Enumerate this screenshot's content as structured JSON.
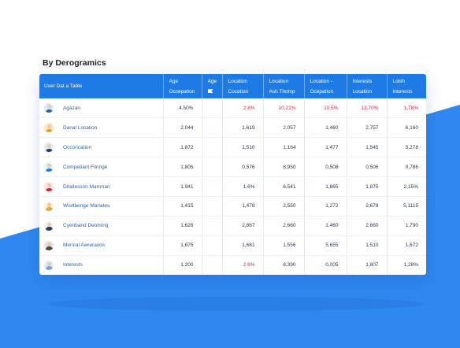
{
  "page_title": "By Derogramics",
  "colors": {
    "accent": "#1e7be6",
    "negative": "#d6253a",
    "link": "#2f5fa8",
    "bg_blue": "#2f88f0"
  },
  "headers": [
    [
      "User Dat a Table",
      ""
    ],
    [
      "Age",
      "Occepation"
    ],
    [
      "Age",
      "flag-icon"
    ],
    [
      "Location",
      "Cocation"
    ],
    [
      "Location",
      "Ash Thomp"
    ],
    [
      "Location -",
      "Ocepation"
    ],
    [
      "Interests",
      "Location"
    ],
    [
      "Loish",
      "Interests"
    ]
  ],
  "rows": [
    {
      "name": "Agazan",
      "avatar": [
        "#d9ecff",
        "#2d5fa3"
      ],
      "cells": [
        "4.50%",
        "",
        "2.8%",
        "10.21%",
        "10.5%",
        "13,70%",
        "1,78%"
      ],
      "red": [
        false,
        false,
        true,
        true,
        true,
        true,
        true
      ]
    },
    {
      "name": "Danal Location",
      "avatar": [
        "#ffe9c2",
        "#e8a21d"
      ],
      "cells": [
        "2,044",
        "",
        "1,619",
        "2,057",
        "1,460",
        "2,757",
        "6,160"
      ],
      "red": [
        false,
        false,
        false,
        false,
        false,
        false,
        false
      ]
    },
    {
      "name": "Occorication",
      "avatar": [
        "#dfeaf7",
        "#1d3f6e"
      ],
      "cells": [
        "1,872",
        "",
        "1,510",
        "1,164",
        "1,477",
        "1,545",
        "5,278"
      ],
      "red": [
        false,
        false,
        false,
        false,
        false,
        false,
        false
      ]
    },
    {
      "name": "Competiant Filnnge",
      "avatar": [
        "#dff3ff",
        "#1e7be6"
      ],
      "cells": [
        "1,805",
        "",
        "0,576",
        "8,950",
        "0,508",
        "0,506",
        "0,786"
      ],
      "red": [
        false,
        false,
        false,
        false,
        false,
        false,
        false
      ]
    },
    {
      "name": "Ditallesson Marrman",
      "avatar": [
        "#ffe1e1",
        "#d6253a"
      ],
      "cells": [
        "1,941",
        "",
        "1.6%",
        "6,541",
        "1,865",
        "1,875",
        "2,15%"
      ],
      "red": [
        false,
        false,
        false,
        false,
        false,
        false,
        false
      ]
    },
    {
      "name": "Wisttbenge Mariates",
      "avatar": [
        "#fff0d6",
        "#e9a73a"
      ],
      "cells": [
        "1,415",
        "",
        "1,478",
        "2,550",
        "1,272",
        "2,678",
        "5,1115"
      ],
      "red": [
        false,
        false,
        false,
        false,
        false,
        false,
        false
      ]
    },
    {
      "name": "Cyenband Deoming",
      "avatar": [
        "#eef2f7",
        "#2b3d5b"
      ],
      "cells": [
        "1,626",
        "",
        "2,867",
        "2,660",
        "1,460",
        "2,660",
        "1,790"
      ],
      "red": [
        false,
        false,
        false,
        false,
        false,
        false,
        false
      ]
    },
    {
      "name": "Merical Awreravos",
      "avatar": [
        "#e6e6e6",
        "#4a4a4a"
      ],
      "cells": [
        "1,675",
        "",
        "1,681",
        "1,556",
        "5,655",
        "1,510",
        "1,672"
      ],
      "red": [
        false,
        false,
        false,
        false,
        false,
        false,
        false
      ]
    },
    {
      "name": "Interests",
      "avatar": [
        "#dcecff",
        "#7aa7d8"
      ],
      "cells": [
        "1,200",
        "",
        "2.6%",
        "8,390",
        "0,005",
        "1,807",
        "1,28%"
      ],
      "red": [
        false,
        false,
        true,
        false,
        false,
        false,
        false
      ]
    }
  ]
}
